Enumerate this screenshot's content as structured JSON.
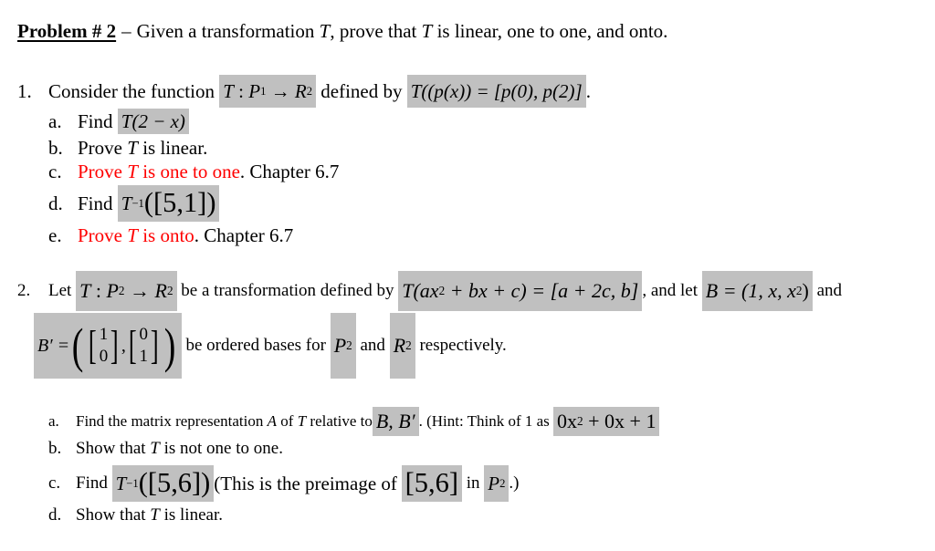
{
  "header": {
    "title": "Problem # 2",
    "dash": "–",
    "intro": "Given a transformation",
    "T": "T",
    "intro2": ", prove that",
    "intro3": "is linear, one to one, and onto."
  },
  "problem1": {
    "number": "1.",
    "text_a": "Consider the function",
    "map_T": "T",
    "map_colon": " : ",
    "map_P": "P",
    "map_P_sub": "1",
    "map_arrow": " → ",
    "map_R": "R",
    "map_R_sup": "2",
    "text_b": "defined by",
    "def_eq": "T((p(x)) = [p(0), p(2)]",
    "period": ".",
    "items": [
      {
        "label": "a.",
        "text": "Find",
        "eq": "T(2 − x)"
      },
      {
        "label": "b.",
        "text": "Prove",
        "T": "T",
        "rest": "is linear."
      },
      {
        "label": "c.",
        "red_text": "Prove",
        "T": "T",
        "red_rest": "is one to one",
        "after": ". Chapter 6.7"
      },
      {
        "label": "d.",
        "text": "Find",
        "eq_T": "T",
        "eq_sup": "−1",
        "eq_arg": "([5,1])"
      },
      {
        "label": "e.",
        "red_text": "Prove",
        "T": "T",
        "red_rest": "is onto",
        "after": ". Chapter 6.7"
      }
    ]
  },
  "problem2": {
    "number": "2.",
    "text_let": "Let",
    "map_T": "T",
    "map_colon": " : ",
    "map_P": "P",
    "map_P_sub": "2",
    "map_arrow": " → ",
    "map_R": "R",
    "map_R_sup": "2",
    "text_b": "be a transformation defined by",
    "def_eq_left": "T(ax",
    "def_sup": "2",
    "def_eq_right": " + bx + c) = [a + 2c, b]",
    "comma": ",",
    "text_and_let": "and let",
    "B_eq": "B = (1, x, x",
    "B_sup": "2",
    "B_close": ")",
    "text_and": "and",
    "Bprime_label": "B′ =",
    "Bprime_v1": [
      "1",
      "0"
    ],
    "Bprime_v2": [
      "0",
      "1"
    ],
    "text_ordered": "be ordered bases for",
    "P2": "P",
    "P2_sub": "2",
    "text_and2": "and",
    "R2": "R",
    "R2_sup": "2",
    "text_resp": "respectively.",
    "items": [
      {
        "label": "a.",
        "text": "Find the matrix representation",
        "A": "A",
        "text2": "of",
        "T": "T",
        "text3": "relative to",
        "eq": "B, B′",
        "text4": ". (Hint: Think of 1 as",
        "hint_eq_a": "0x",
        "hint_sup": "2",
        "hint_eq_b": " + 0x + 1"
      },
      {
        "label": "b.",
        "text": "Show that",
        "T": "T",
        "rest": "is not one to one."
      },
      {
        "label": "c.",
        "text": "Find",
        "eq_T": "T",
        "eq_sup": "−1",
        "eq_arg": "([5,6])",
        "text2": "(This is the preimage of",
        "eq2": "[5,6]",
        "text3": "in",
        "eq3": "P",
        "eq3_sub": "2",
        "text4": ".)"
      },
      {
        "label": "d.",
        "text": "Show that",
        "T": "T",
        "rest": "is linear."
      }
    ]
  },
  "colors": {
    "highlight": "#c0c0c0",
    "red": "#ff0000",
    "text": "#000000"
  }
}
